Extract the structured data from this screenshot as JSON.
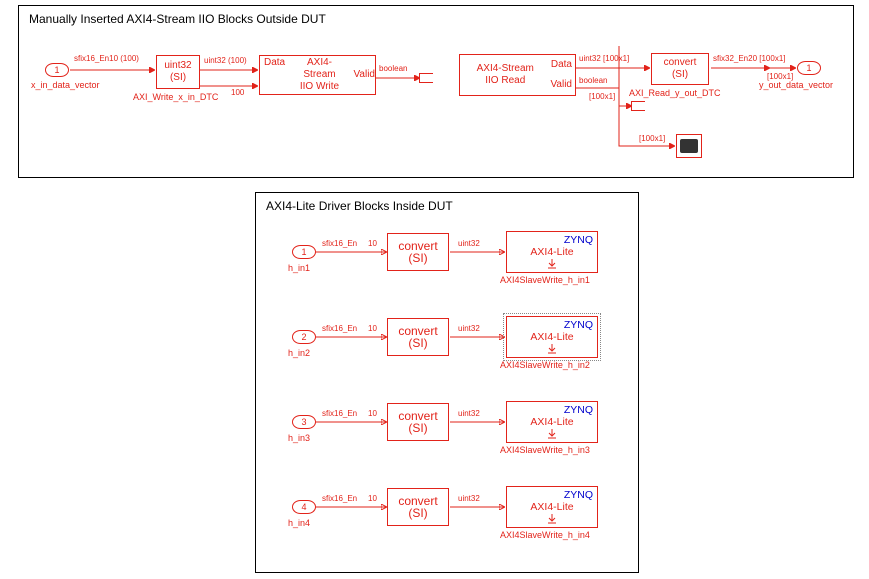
{
  "panel1": {
    "title": "Manually Inserted AXI4-Stream IIO Blocks Outside DUT",
    "inport": {
      "num": "1",
      "name": "x_in_data_vector"
    },
    "outport": {
      "num": "1",
      "name": "y_out_data_vector"
    },
    "dtc_in": {
      "top": "uint32",
      "bot": "(SI)",
      "name": "AXI_Write_x_in_DTC"
    },
    "dtc_out": {
      "top": "convert",
      "bot": "(SI)",
      "name": "AXI_Read_y_out_DTC"
    },
    "iiowrite": {
      "p1": "Data",
      "title": "AXI4-Stream\nIIO Write",
      "p2": "Valid"
    },
    "iioread": {
      "p1": "Data",
      "title": "AXI4-Stream\nIIO Read",
      "p2": "Valid"
    },
    "sig_in": "sfix16_En10 (100)",
    "sig_u32100a": "uint32 (100)",
    "sig_100": "100",
    "sig_bool": "boolean",
    "sig_u32dim": "uint32 [100x1]",
    "sig_booldim": "boolean",
    "sig_dim100": "[100x1]",
    "sig_out": "sfix32_En20 [100x1]"
  },
  "panel2": {
    "title": "AXI4-Lite Driver Blocks Inside DUT",
    "rows": [
      {
        "num": "1",
        "port": "h_in1",
        "sig_in": "sfix16_En",
        "sig_10": "10",
        "sig_mid": "uint32",
        "conv_t": "convert",
        "conv_b": "(SI)",
        "z_t": "ZYNQ",
        "z_m": "AXI4-Lite",
        "z_name": "AXI4SlaveWrite_h_in1"
      },
      {
        "num": "2",
        "port": "h_in2",
        "sig_in": "sfix16_En",
        "sig_10": "10",
        "sig_mid": "uint32",
        "conv_t": "convert",
        "conv_b": "(SI)",
        "z_t": "ZYNQ",
        "z_m": "AXI4-Lite",
        "z_name": "AXI4SlaveWrite_h_in2"
      },
      {
        "num": "3",
        "port": "h_in3",
        "sig_in": "sfix16_En",
        "sig_10": "10",
        "sig_mid": "uint32",
        "conv_t": "convert",
        "conv_b": "(SI)",
        "z_t": "ZYNQ",
        "z_m": "AXI4-Lite",
        "z_name": "AXI4SlaveWrite_h_in3"
      },
      {
        "num": "4",
        "port": "h_in4",
        "sig_in": "sfix16_En",
        "sig_10": "10",
        "sig_mid": "uint32",
        "conv_t": "convert",
        "conv_b": "(SI)",
        "z_t": "ZYNQ",
        "z_m": "AXI4-Lite",
        "z_name": "AXI4SlaveWrite_h_in4"
      }
    ]
  }
}
